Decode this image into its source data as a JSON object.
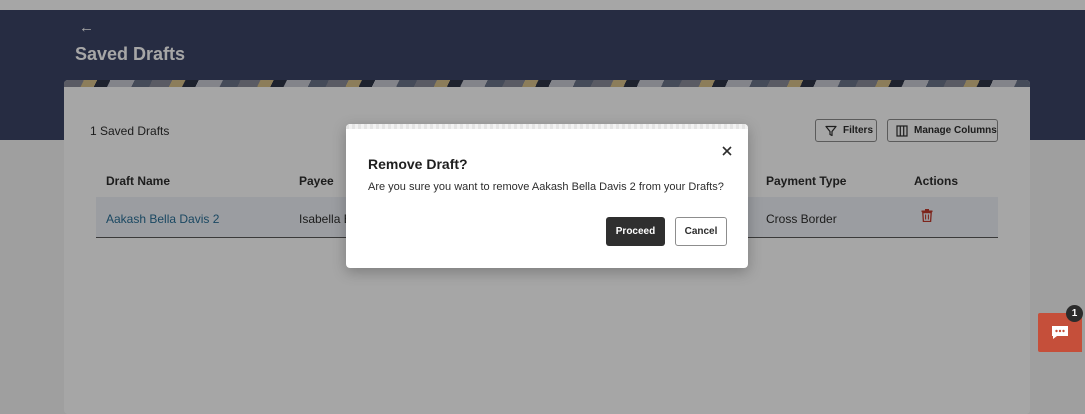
{
  "header": {
    "back_icon": "back-arrow-icon",
    "back_glyph": "←",
    "title": "Saved Drafts"
  },
  "toolbar": {
    "saved_count": "1 Saved Drafts",
    "filters_label": "Filters",
    "filters_icon": "filter-icon",
    "manage_columns_label": "Manage Columns",
    "manage_columns_icon": "columns-icon"
  },
  "table": {
    "columns": [
      "Draft Name",
      "Payee",
      "Payment Type",
      "Actions"
    ],
    "rows": [
      {
        "draft_name": "Aakash Bella Davis 2",
        "payee": "Isabella B",
        "payment_type": "Cross Border",
        "action_icon": "trash-icon"
      }
    ]
  },
  "modal": {
    "title": "Remove Draft?",
    "message": "Are you sure you want to remove Aakash Bella Davis 2 from your Drafts?",
    "close_glyph": "×",
    "proceed_label": "Proceed",
    "cancel_label": "Cancel"
  },
  "chat": {
    "icon": "chat-icon",
    "badge_count": "1"
  },
  "colors": {
    "header_bg": "#3b4466",
    "link": "#2a6f97",
    "danger": "#c0392b",
    "primary_button": "#2f2f2f",
    "chat_button": "#c54f3a"
  }
}
